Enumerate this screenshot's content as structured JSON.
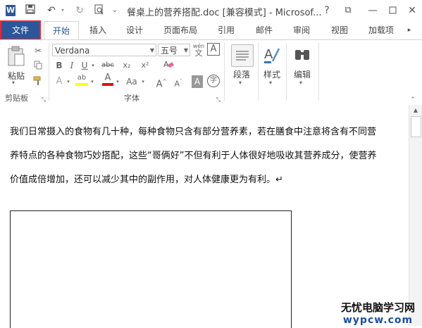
{
  "title_bar": {
    "app_icon": "W",
    "quick_access": {
      "save_icon": "save-icon",
      "undo_icon": "undo-icon",
      "redo_icon": "redo-icon",
      "print_preview_icon": "print-preview-icon",
      "customize_icon": "customize-qat-icon"
    },
    "document_title": "餐桌上的营养搭配.doc [兼容模式] - Microsof...",
    "buttons": {
      "help": "?",
      "ribbon_display": "⧉",
      "minimize": "—"
    }
  },
  "tabs": {
    "file": "文件",
    "home": "开始",
    "insert": "插入",
    "design": "设计",
    "layout": "页面布局",
    "references": "引用",
    "mailings": "邮件",
    "review": "审阅",
    "view": "视图",
    "addins": "加载项"
  },
  "ribbon": {
    "clipboard": {
      "paste_label": "粘贴",
      "group_label": "剪贴板"
    },
    "font": {
      "font_name": "Verdana",
      "font_size": "五号",
      "group_label": "字体",
      "phonetic": "wén",
      "bold": "B",
      "italic": "I",
      "underline": "U",
      "strikethrough": "abc",
      "subscript": "x₂",
      "superscript": "x²",
      "text_effects": "A",
      "highlight": "ab",
      "font_color": "A",
      "change_case": "Aa",
      "grow_font": "A",
      "shrink_font": "A",
      "char_shading": "A",
      "enclose_char": "字"
    },
    "paragraph": {
      "label": "段落"
    },
    "styles": {
      "label": "样式"
    },
    "editing": {
      "label": "编辑"
    }
  },
  "document": {
    "paragraph_lines": [
      "我们日常摄入的食物有几十种，每种食物只含有部分营养素，若在膳食中注意将含有不同营",
      "养特点的各种食物巧妙搭配，这些“哥俩好”不但有利于人体很好地吸收其营养成分，使营养",
      "价值成倍增加，还可以减少其中的副作用，对人体健康更为有利。↵"
    ]
  },
  "watermark": {
    "line1": "无忧电脑学习网",
    "line2": "wypcw.com"
  },
  "colors": {
    "accent": "#2b579a",
    "file_tab_outline": "#ee2233",
    "watermark_blue": "#1a4ea8"
  }
}
